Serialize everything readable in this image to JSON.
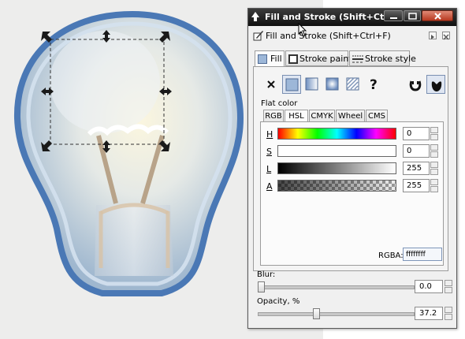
{
  "dialog": {
    "title": "Fill and Stroke (Shift+Ctrl...",
    "subheader": "Fill and Stroke (Shift+Ctrl+F)"
  },
  "tabs": [
    {
      "label": "Fill"
    },
    {
      "label": "Stroke paint"
    },
    {
      "label": "Stroke style"
    }
  ],
  "paint_types": [
    "no-paint",
    "flat-color",
    "linear-gradient",
    "radial-gradient",
    "pattern",
    "unset"
  ],
  "fill_rule": [
    "evenodd",
    "nonzero"
  ],
  "flat_color_label": "Flat color",
  "color_tabs": [
    {
      "label": "RGB"
    },
    {
      "label": "HSL"
    },
    {
      "label": "CMYK"
    },
    {
      "label": "Wheel"
    },
    {
      "label": "CMS"
    }
  ],
  "sliders": [
    {
      "label": "H",
      "value": "0"
    },
    {
      "label": "S",
      "value": "0"
    },
    {
      "label": "L",
      "value": "255"
    },
    {
      "label": "A",
      "value": "255"
    }
  ],
  "rgba": {
    "label": "RGBA:",
    "value": "ffffffff"
  },
  "blur": {
    "label": "Blur:",
    "value": "0.0",
    "fraction": 0.0
  },
  "opacity": {
    "label": "Opacity, %",
    "value": "37.2",
    "fraction": 0.372
  },
  "colors": {
    "titlebar": "#1a1a1a",
    "bulb_outline": "#4a78b5",
    "selection_handle": "#1a1a1a"
  }
}
